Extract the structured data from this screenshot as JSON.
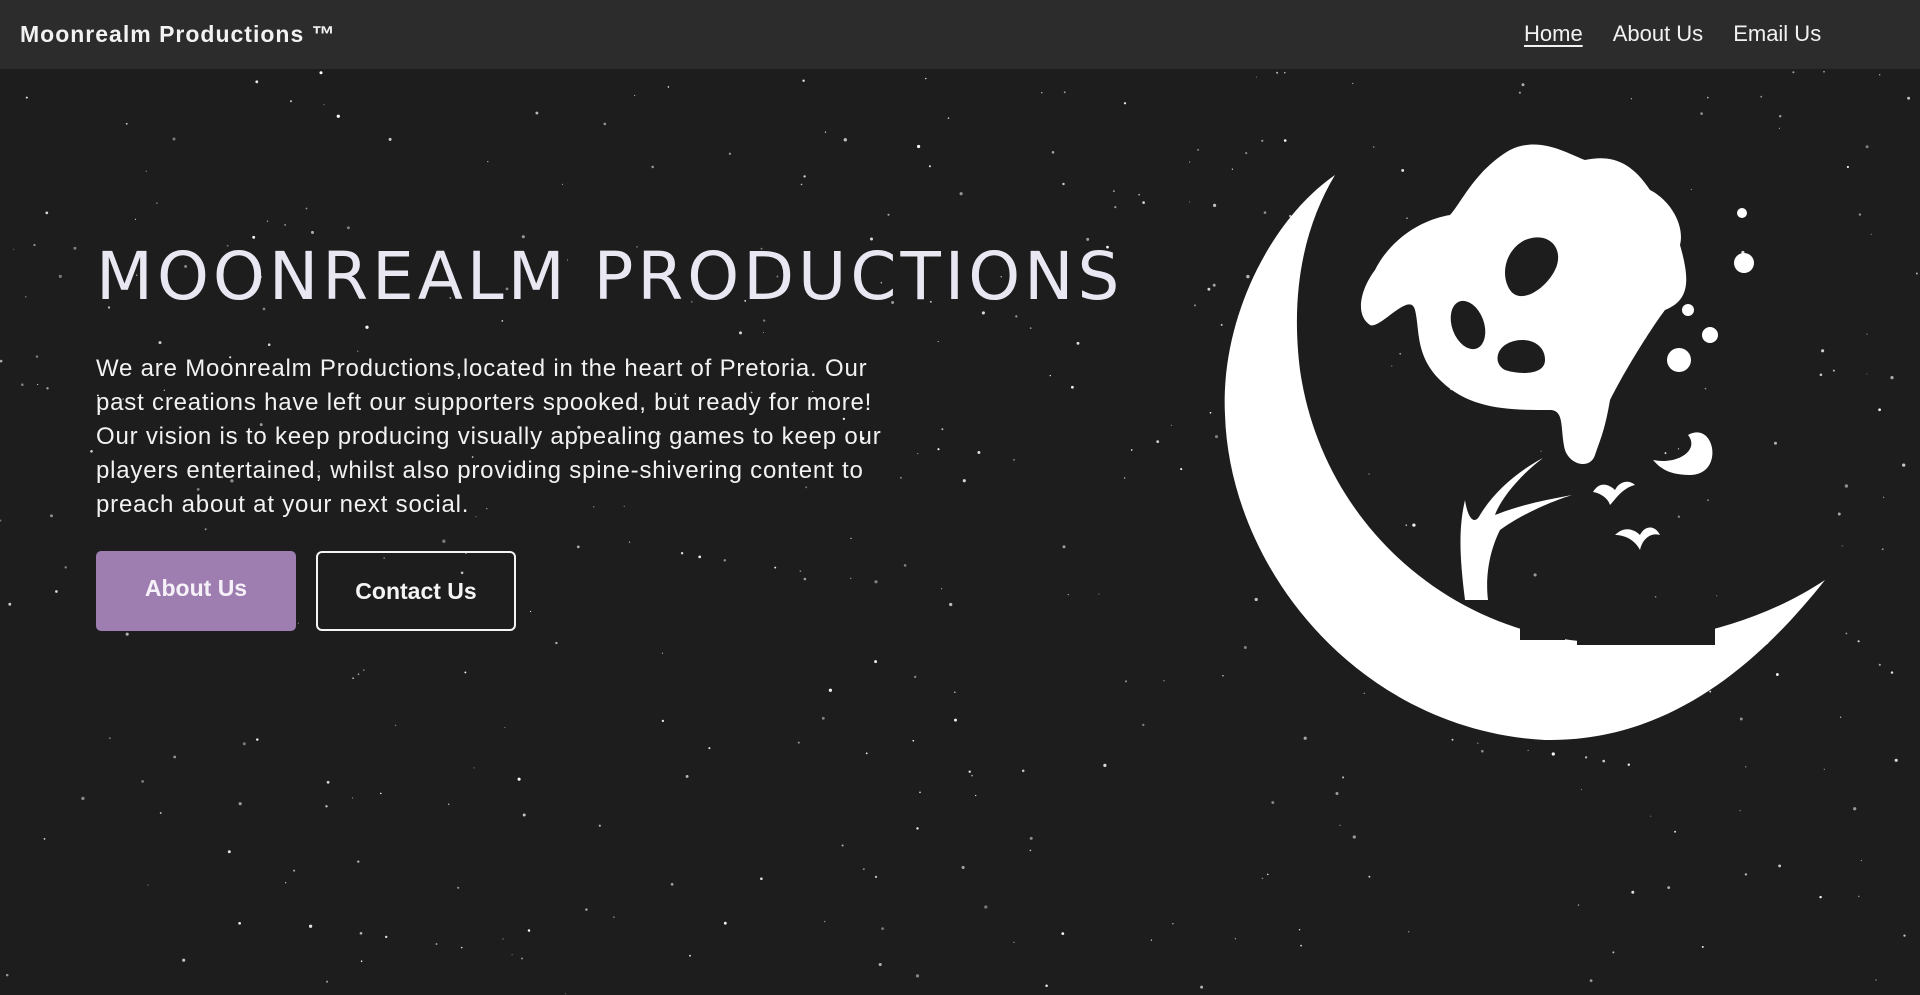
{
  "nav": {
    "brand": "Moonrealm Productions ™",
    "links": [
      {
        "label": "Home",
        "active": true
      },
      {
        "label": "About Us",
        "active": false
      },
      {
        "label": "Email Us",
        "active": false
      }
    ]
  },
  "hero": {
    "title": "MOONREALM PRODUCTIONS",
    "description": "We are Moonrealm Productions,located in the heart of Pretoria. Our past creations have left our supporters spooked, but ready for more! Our vision is to keep producing visually appealing games to keep our players entertained, whilst also providing spine-shivering content to preach about at your next social.",
    "buttons": {
      "about": "About Us",
      "contact": "Contact Us"
    },
    "logo_icon": "moon-ghost-graveyard-logo"
  },
  "colors": {
    "background": "#1d1d1e",
    "navbar": "#2c2c2c",
    "accent": "#9e7db0",
    "text": "#f2f2f2"
  }
}
